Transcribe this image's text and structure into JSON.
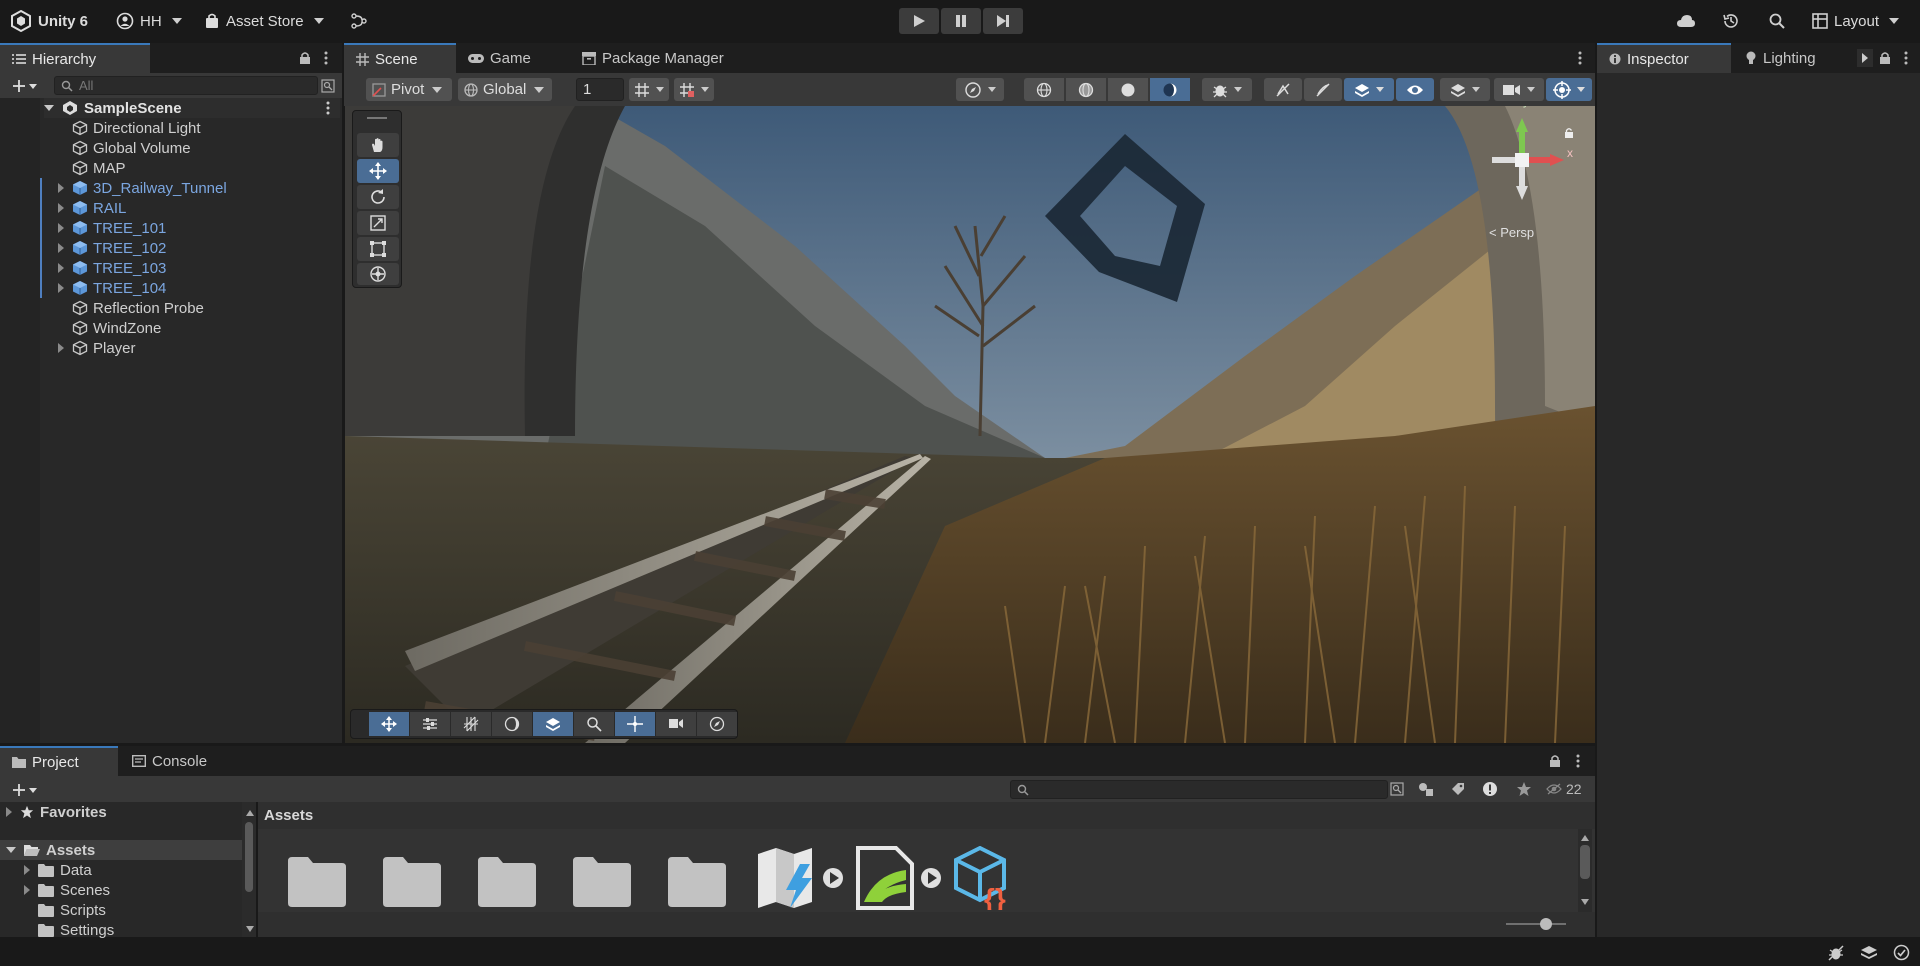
{
  "topbar": {
    "app_title": "Unity 6",
    "account": "HH",
    "asset_store": "Asset Store",
    "layout": "Layout"
  },
  "hierarchy": {
    "tab_label": "Hierarchy",
    "search_placeholder": "All",
    "scene_name": "SampleScene",
    "items": [
      {
        "label": "Directional Light",
        "prefab": false,
        "expandable": false
      },
      {
        "label": "Global Volume",
        "prefab": false,
        "expandable": false
      },
      {
        "label": "MAP",
        "prefab": false,
        "expandable": false
      },
      {
        "label": "3D_Railway_Tunnel",
        "prefab": true,
        "expandable": true
      },
      {
        "label": "RAIL",
        "prefab": true,
        "expandable": true
      },
      {
        "label": "TREE_101",
        "prefab": true,
        "expandable": true
      },
      {
        "label": "TREE_102",
        "prefab": true,
        "expandable": true
      },
      {
        "label": "TREE_103",
        "prefab": true,
        "expandable": true
      },
      {
        "label": "TREE_104",
        "prefab": true,
        "expandable": true
      },
      {
        "label": "Reflection Probe",
        "prefab": false,
        "expandable": false
      },
      {
        "label": "WindZone",
        "prefab": false,
        "expandable": false
      },
      {
        "label": "Player",
        "prefab": false,
        "expandable": true
      }
    ]
  },
  "scene": {
    "tabs": [
      {
        "label": "Scene"
      },
      {
        "label": "Game"
      },
      {
        "label": "Package Manager"
      }
    ],
    "pivot": "Pivot",
    "global": "Global",
    "grid_value": "1",
    "gizmo_label": "< Persp",
    "axis_x": "x",
    "axis_y": "y"
  },
  "inspector": {
    "tab_inspector": "Inspector",
    "tab_lighting": "Lighting"
  },
  "project": {
    "tab_project": "Project",
    "tab_console": "Console",
    "favorites": "Favorites",
    "assets_root": "Assets",
    "tree": [
      "Data",
      "Scenes",
      "Scripts",
      "Settings"
    ],
    "breadcrumb": "Assets",
    "hidden_count": "22"
  },
  "colors": {
    "accent": "#3a79bb",
    "prefab_text": "#7ba6e0",
    "panel_bg": "#282828",
    "toolbar_bg": "#383838"
  }
}
